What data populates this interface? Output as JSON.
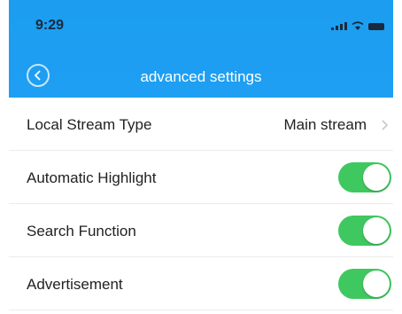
{
  "status_bar": {
    "time": "9:29"
  },
  "nav": {
    "title": "advanced settings"
  },
  "settings": [
    {
      "label": "Local Stream Type",
      "value": "Main stream"
    },
    {
      "label": "Automatic Highlight",
      "enabled": true
    },
    {
      "label": "Search Function",
      "enabled": true
    },
    {
      "label": "Advertisement",
      "enabled": true
    }
  ],
  "colors": {
    "header_blue": "#1e9ff3",
    "toggle_on": "#3fc85f"
  }
}
